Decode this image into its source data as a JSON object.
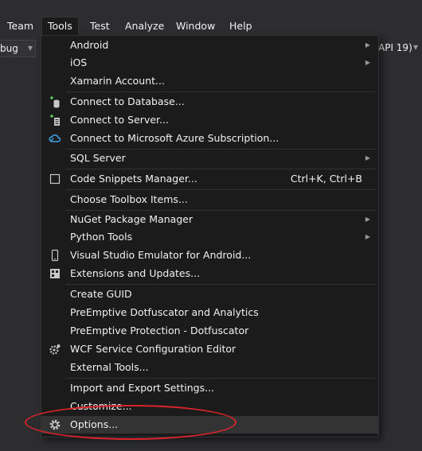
{
  "menubar": {
    "items": [
      "Team",
      "Tools",
      "Test",
      "Analyze",
      "Window",
      "Help"
    ]
  },
  "toolbar": {
    "config_combo": "bug",
    "target_text": "API 19)"
  },
  "tools_menu": {
    "items": [
      {
        "label": "Android",
        "submenu": true
      },
      {
        "label": "iOS",
        "submenu": true
      },
      {
        "label": "Xamarin Account..."
      },
      {
        "label": "Connect to Database...",
        "icon": "database-connect-icon"
      },
      {
        "label": "Connect to Server...",
        "icon": "server-connect-icon"
      },
      {
        "label": "Connect to Microsoft Azure Subscription...",
        "icon": "azure-cloud-icon"
      },
      {
        "label": "SQL Server",
        "submenu": true
      },
      {
        "label": "Code Snippets Manager...",
        "shortcut": "Ctrl+K, Ctrl+B",
        "icon": "snippet-icon"
      },
      {
        "label": "Choose Toolbox Items..."
      },
      {
        "label": "NuGet Package Manager",
        "submenu": true
      },
      {
        "label": "Python Tools",
        "submenu": true
      },
      {
        "label": "Visual Studio Emulator for Android...",
        "icon": "phone-icon"
      },
      {
        "label": "Extensions and Updates...",
        "icon": "extensions-icon"
      },
      {
        "label": "Create GUID"
      },
      {
        "label": "PreEmptive Dotfuscator and Analytics"
      },
      {
        "label": "PreEmptive Protection - Dotfuscator"
      },
      {
        "label": "WCF Service Configuration Editor",
        "icon": "wcf-gear-icon"
      },
      {
        "label": "External Tools..."
      },
      {
        "label": "Import and Export Settings..."
      },
      {
        "label": "Customize..."
      },
      {
        "label": "Options...",
        "icon": "gear-icon",
        "highlighted": true
      }
    ]
  },
  "colors": {
    "background": "#2d2d30",
    "menu_background": "#1b1b1c",
    "highlight": "#333334",
    "annotation_oval": "#d9252a"
  }
}
